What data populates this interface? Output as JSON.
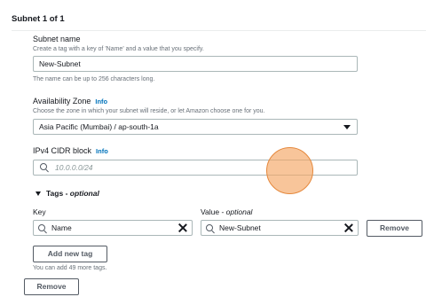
{
  "panel": {
    "title": "Subnet 1 of 1"
  },
  "subnet_name": {
    "label": "Subnet name",
    "description": "Create a tag with a key of 'Name' and a value that you specify.",
    "value": "New-Subnet",
    "constraint": "The name can be up to 256 characters long."
  },
  "availability_zone": {
    "label": "Availability Zone",
    "info": "Info",
    "description": "Choose the zone in which your subnet will reside, or let Amazon choose one for you.",
    "selected": "Asia Pacific (Mumbai) / ap-south-1a"
  },
  "cidr": {
    "label": "IPv4 CIDR block",
    "info": "Info",
    "placeholder": "10.0.0.0/24"
  },
  "tags": {
    "toggle_label": "Tags - ",
    "toggle_optional": "optional",
    "key_header": "Key",
    "value_header": "Value - ",
    "value_optional": "optional",
    "rows": [
      {
        "key": "Name",
        "value": "New-Subnet",
        "remove_label": "Remove"
      }
    ],
    "add_label": "Add new tag",
    "remaining_hint": "You can add 49 more tags."
  },
  "remove_subnet_label": "Remove",
  "icons": {
    "search": "search-icon",
    "clear": "close-icon",
    "dropdown": "caret-down-icon",
    "expand": "caret-down-icon"
  }
}
